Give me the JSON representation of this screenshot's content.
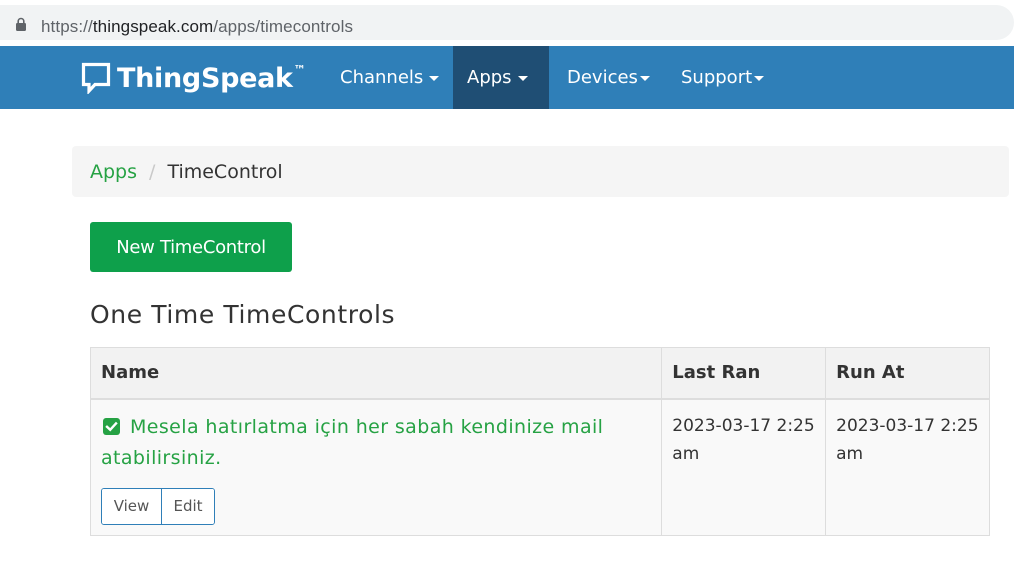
{
  "browser": {
    "url_prefix": "https://",
    "url_host": "thingspeak.com",
    "url_path": "/apps/timecontrols"
  },
  "navbar": {
    "brand": "ThingSpeak",
    "brand_mark": "™",
    "items": [
      {
        "label": "Channels",
        "active": false
      },
      {
        "label": "Apps",
        "active": true
      },
      {
        "label": "Devices",
        "active": false
      },
      {
        "label": "Support",
        "active": false
      }
    ]
  },
  "breadcrumb": {
    "parent": "Apps",
    "separator": "/",
    "current": "TimeControl"
  },
  "actions": {
    "new_label": "New TimeControl"
  },
  "section": {
    "title": "One Time TimeControls"
  },
  "table": {
    "headers": [
      "Name",
      "Last Ran",
      "Run At"
    ],
    "rows": [
      {
        "name": "Mesela hatırlatma için her sabah kendinize mail atabilirsiniz.",
        "last_ran": "2023-03-17 2:25 am",
        "run_at": "2023-03-17 2:25 am",
        "view_label": "View",
        "edit_label": "Edit"
      }
    ]
  },
  "colors": {
    "navbar": "#2f7fb8",
    "navbar_active": "#1f4e74",
    "primary_green": "#0ea04b",
    "link_green": "#26a244"
  },
  "icons": {
    "address_bar": "lock-icon",
    "brand": "speech-bubble-icon",
    "row_status": "check-square-icon"
  }
}
